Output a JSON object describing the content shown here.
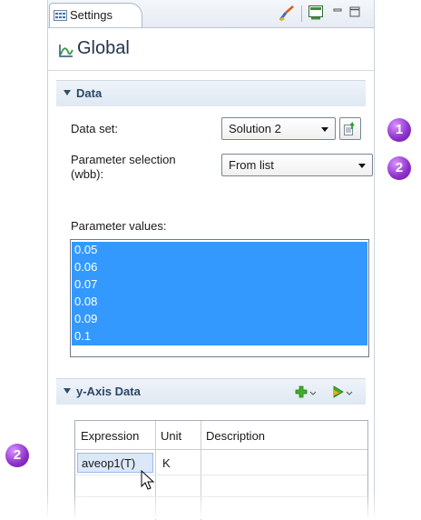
{
  "tab": {
    "label": "Settings"
  },
  "page": {
    "title": "Global"
  },
  "data_section": {
    "title": "Data",
    "dataset_label": "Data set:",
    "dataset_value": "Solution 2",
    "param_sel_label_line1": "Parameter selection",
    "param_sel_label_line2": "(wbb):",
    "param_sel_value": "From list",
    "param_values_label": "Parameter values:",
    "param_values": [
      "0.05",
      "0.06",
      "0.07",
      "0.08",
      "0.09",
      "0.1"
    ]
  },
  "yaxis_section": {
    "title": "y-Axis Data",
    "columns": [
      "Expression",
      "Unit",
      "Description"
    ],
    "rows": [
      {
        "expression": "aveop1(T)",
        "unit": "K",
        "description": ""
      }
    ]
  },
  "badges": {
    "first": "1",
    "second": "2",
    "third": "2"
  },
  "colors": {
    "accent": "#3399ff",
    "badge": "#8a2fc9",
    "header_text": "#2b4669"
  },
  "icons": [
    "settings-tab-icon",
    "brush-icon",
    "window-icon",
    "minimize-icon",
    "maximize-icon",
    "plot-icon",
    "collapse-arrow-icon",
    "refresh-dataset-icon",
    "add-icon",
    "move-icon",
    "cursor-icon"
  ]
}
